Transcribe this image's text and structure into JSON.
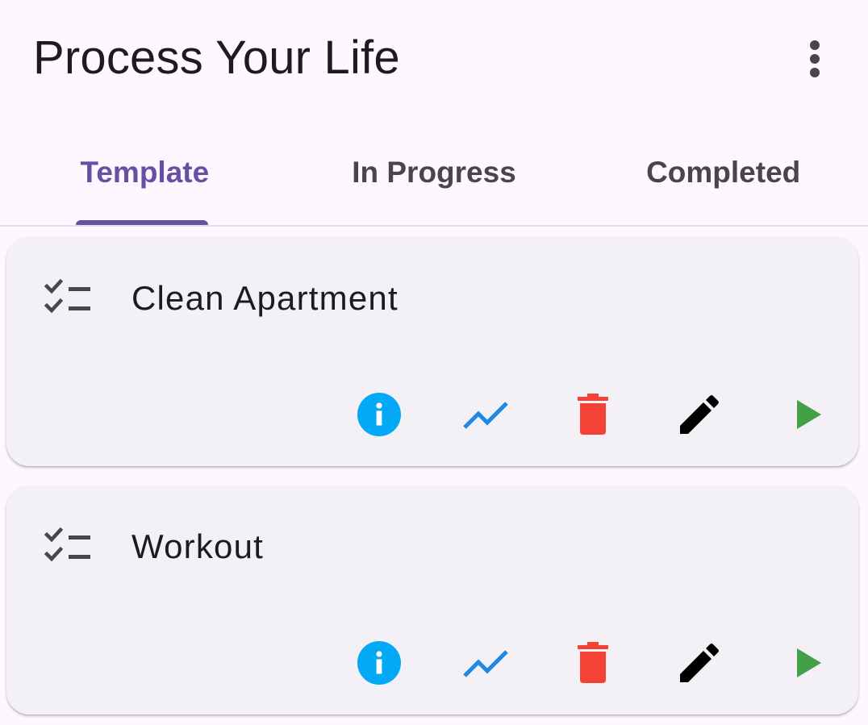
{
  "app_bar": {
    "title": "Process Your Life",
    "menu_icon": "more-vert-icon"
  },
  "tabs": [
    {
      "label": "Template",
      "active": true
    },
    {
      "label": "In Progress",
      "active": false
    },
    {
      "label": "Completed",
      "active": false
    }
  ],
  "colors": {
    "primary": "#6750a4",
    "info": "#03a9f4",
    "stats": "#1e88e5",
    "delete": "#f44336",
    "edit": "#000000",
    "start": "#43a047"
  },
  "templates": [
    {
      "title": "Clean Apartment",
      "leading_icon": "checklist-icon",
      "actions": [
        "info-icon",
        "trending-up-icon",
        "delete-icon",
        "edit-icon",
        "play-icon"
      ]
    },
    {
      "title": "Workout",
      "leading_icon": "checklist-icon",
      "actions": [
        "info-icon",
        "trending-up-icon",
        "delete-icon",
        "edit-icon",
        "play-icon"
      ]
    }
  ]
}
